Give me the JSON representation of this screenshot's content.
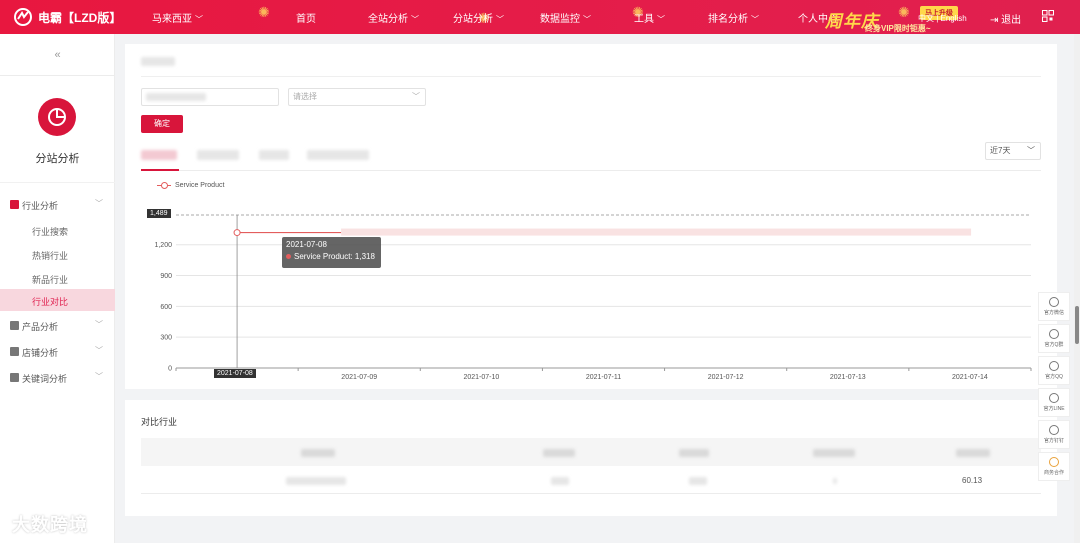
{
  "topbar": {
    "brand": "电霸【LZD版】",
    "nav": [
      {
        "label": "马来西亚",
        "dropdown": true
      },
      {
        "label": "首页",
        "dropdown": false
      },
      {
        "label": "全站分析",
        "dropdown": true
      },
      {
        "label": "分站分析",
        "dropdown": true
      },
      {
        "label": "数据监控",
        "dropdown": true
      },
      {
        "label": "工具",
        "dropdown": true
      },
      {
        "label": "排名分析",
        "dropdown": true
      },
      {
        "label": "个人中心",
        "dropdown": false
      }
    ],
    "promo_title": "周年庆",
    "promo_sub": "终身VIP限时钜惠~",
    "promo_button": "马上升级",
    "lang": "中文 | English",
    "logout": "退出",
    "accent": "#e41d4a"
  },
  "sidebar": {
    "collapse_glyph": "«",
    "module_title": "分站分析",
    "menu": [
      {
        "label": "行业分析",
        "expanded": true
      },
      {
        "label": "产品分析",
        "expanded": false
      },
      {
        "label": "店铺分析",
        "expanded": false
      },
      {
        "label": "关键词分析",
        "expanded": false
      }
    ],
    "submenu": [
      {
        "label": "行业搜索"
      },
      {
        "label": "热销行业"
      },
      {
        "label": "新品行业"
      },
      {
        "label": "行业对比",
        "active": true
      }
    ]
  },
  "filters": {
    "select_placeholder": "请选择",
    "confirm": "确定",
    "range": "近7天"
  },
  "chart_data": {
    "type": "line",
    "x": [
      "2021-07-08",
      "2021-07-09",
      "2021-07-10",
      "2021-07-11",
      "2021-07-12",
      "2021-07-13",
      "2021-07-14"
    ],
    "series": [
      {
        "name": "Service Product",
        "values": [
          1318,
          null,
          null,
          null,
          null,
          null,
          null
        ]
      }
    ],
    "yticks": [
      0,
      300,
      600,
      900,
      1200
    ],
    "ylim": [
      0,
      1489
    ],
    "ymax_label": "1,489",
    "ytick_labels": [
      "0",
      "300",
      "600",
      "900",
      "1,200"
    ],
    "tooltip": {
      "date": "2021-07-08",
      "label": "Service Product: 1,318"
    },
    "grid": true,
    "legend_position": "top-left",
    "series_color": "#e35d5d"
  },
  "compare": {
    "title": "对比行业",
    "row_value": "60.13"
  },
  "float_tools": [
    {
      "label": "官方微信"
    },
    {
      "label": "官方Q群"
    },
    {
      "label": "官方QQ"
    },
    {
      "label": "官方LINE"
    },
    {
      "label": "官方钉钉"
    },
    {
      "label": "商务合作"
    }
  ],
  "watermark": "大数跨境"
}
